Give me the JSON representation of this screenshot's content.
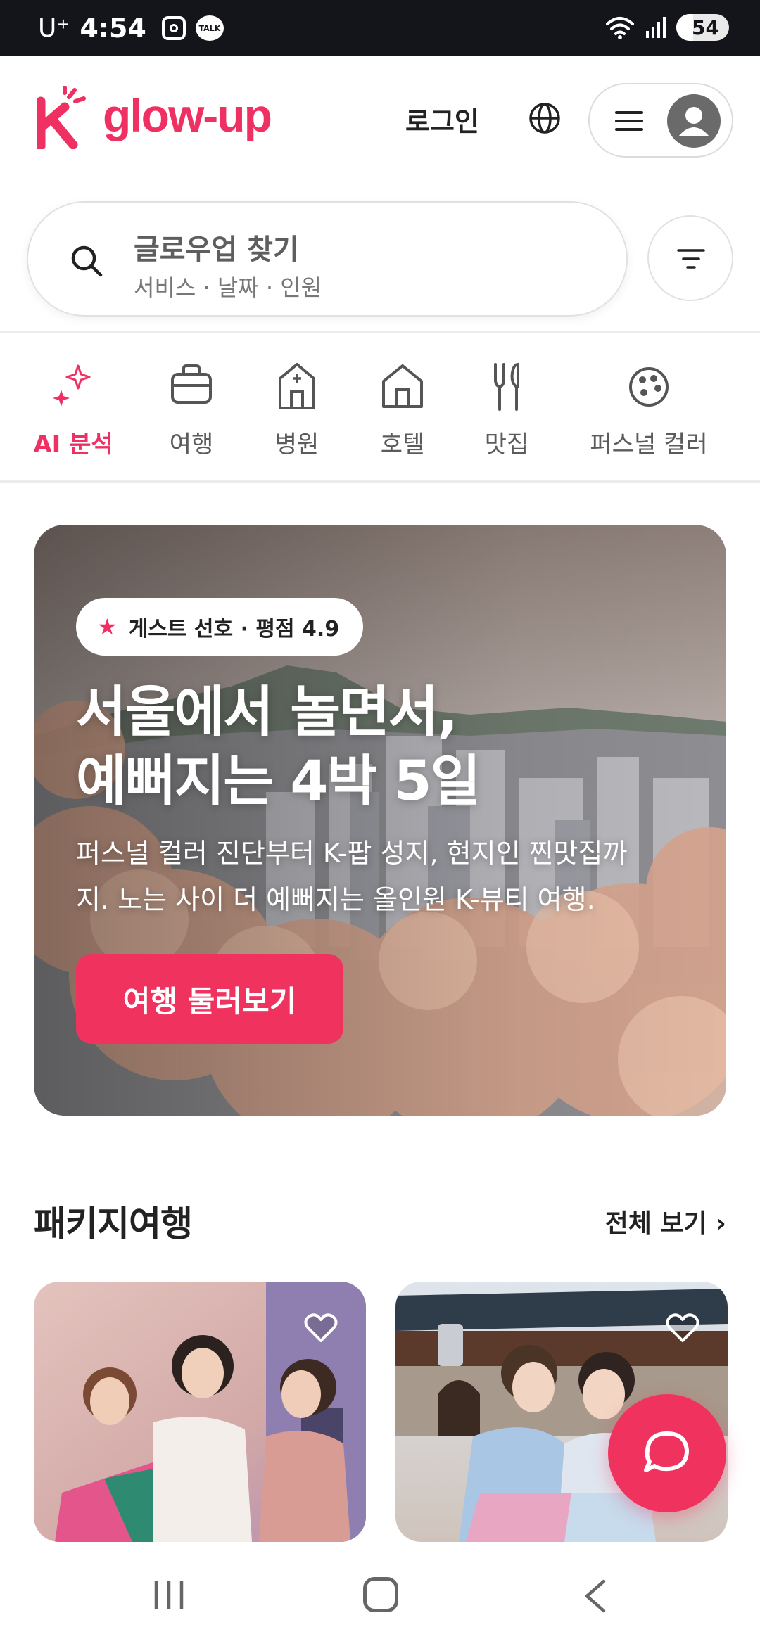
{
  "status_bar": {
    "carrier": "U⁺",
    "time": "4:54",
    "talk_label": "TALK",
    "battery": "54",
    "icons": [
      "instagram-icon",
      "kakaotalk-icon",
      "wifi-icon",
      "signal-icon",
      "battery-icon"
    ]
  },
  "header": {
    "logo_mark": "K",
    "logo_text": "glow-up",
    "login": "로그인",
    "brand_color": "#ee3063"
  },
  "search": {
    "title": "글로우업 찾기",
    "subtitle": "서비스 · 날짜 · 인원"
  },
  "categories": [
    {
      "label": "AI 분석",
      "icon": "sparkle-icon",
      "active": true
    },
    {
      "label": "여행",
      "icon": "suitcase-icon",
      "active": false
    },
    {
      "label": "병원",
      "icon": "hospital-icon",
      "active": false
    },
    {
      "label": "호텔",
      "icon": "hotel-icon",
      "active": false
    },
    {
      "label": "맛집",
      "icon": "utensils-icon",
      "active": false
    },
    {
      "label": "퍼스널 컬러",
      "icon": "palette-icon",
      "active": false
    }
  ],
  "hero": {
    "badge": "게스트 선호 · 평점 4.9",
    "title_line1": "서울에서 놀면서,",
    "title_line2": "예뻐지는 4박 5일",
    "desc_line1": "퍼스널 컬러 진단부터 K-팝 성지, 현지인 찐맛집까",
    "desc_line2": "지. 노는 사이 더 예뻐지는 올인원 K-뷰티 여행.",
    "cta": "여행 둘러보기"
  },
  "packages": {
    "title": "패키지여행",
    "more": "전체 보기 ›"
  },
  "accent_color": "#f0325f"
}
